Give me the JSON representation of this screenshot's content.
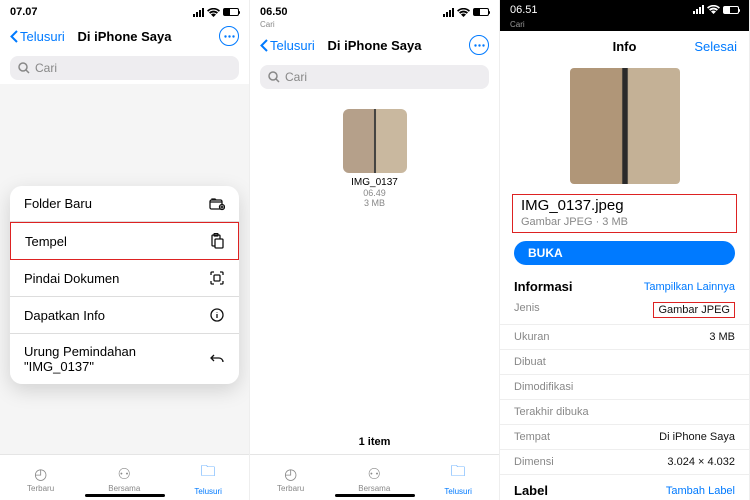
{
  "screens": [
    {
      "status_time": "07.07",
      "back_label": "Telusuri",
      "title": "Di iPhone Saya",
      "search_placeholder": "Cari",
      "menu": [
        {
          "label": "Folder Baru",
          "icon": "folder-plus"
        },
        {
          "label": "Tempel",
          "icon": "clipboard",
          "highlight": true
        },
        {
          "label": "Pindai Dokumen",
          "icon": "scan"
        },
        {
          "label": "Dapatkan Info",
          "icon": "info"
        },
        {
          "label": "Urung Pemindahan \"IMG_0137\"",
          "icon": "undo"
        }
      ],
      "tabs": [
        {
          "label": "Terbaru",
          "icon": "clock"
        },
        {
          "label": "Bersama",
          "icon": "shared"
        },
        {
          "label": "Telusuri",
          "icon": "folder",
          "active": true
        }
      ]
    },
    {
      "status_time": "06.50",
      "status_sub": "Cari",
      "back_label": "Telusuri",
      "title": "Di iPhone Saya",
      "search_placeholder": "Cari",
      "file": {
        "name": "IMG_0137",
        "time": "06.49",
        "size": "3 MB"
      },
      "item_count": "1 item",
      "tabs": [
        {
          "label": "Terbaru",
          "icon": "clock"
        },
        {
          "label": "Bersama",
          "icon": "shared"
        },
        {
          "label": "Telusuri",
          "icon": "folder",
          "active": true
        }
      ]
    },
    {
      "status_time": "06.51",
      "status_sub": "Cari",
      "info_title": "Info",
      "done_label": "Selesai",
      "filename": "IMG_0137.jpeg",
      "filetype_sub": "Gambar JPEG · 3 MB",
      "open_label": "BUKA",
      "section_title": "Informasi",
      "show_more": "Tampilkan Lainnya",
      "rows": [
        {
          "k": "Jenis",
          "v": "Gambar JPEG",
          "highlight": true
        },
        {
          "k": "Ukuran",
          "v": "3 MB"
        },
        {
          "k": "Dibuat",
          "v": ""
        },
        {
          "k": "Dimodifikasi",
          "v": ""
        },
        {
          "k": "Terakhir dibuka",
          "v": ""
        },
        {
          "k": "Tempat",
          "v": "Di iPhone Saya"
        },
        {
          "k": "Dimensi",
          "v": "3.024 × 4.032"
        }
      ],
      "label_title": "Label",
      "add_label": "Tambah Label"
    }
  ]
}
